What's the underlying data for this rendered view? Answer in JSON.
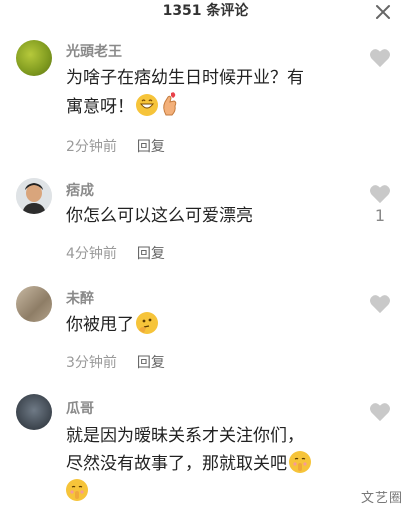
{
  "header": {
    "title": "1351 条评论"
  },
  "comments": [
    {
      "username": "光頭老王",
      "lines": [
        "为啥子在痞幼生日时候开业？有",
        "寓意呀！"
      ],
      "time": "2分钟前",
      "reply_label": "回复",
      "like_count": "",
      "avatar_icon": "green-bush-avatar-icon",
      "emojis": [
        "grin-emoji-icon",
        "finger-heart-emoji-icon"
      ]
    },
    {
      "username": "痞成",
      "lines": [
        "你怎么可以这么可爱漂亮"
      ],
      "time": "4分钟前",
      "reply_label": "回复",
      "like_count": "1",
      "avatar_icon": "person-avatar-icon",
      "emojis": []
    },
    {
      "username": "未醉",
      "lines": [
        "你被甩了"
      ],
      "time": "3分钟前",
      "reply_label": "回复",
      "like_count": "",
      "avatar_icon": "pet-avatar-icon",
      "emojis": [
        "thinking-emoji-icon"
      ]
    },
    {
      "username": "瓜哥",
      "lines": [
        "就是因为暧昧关系才关注你们，",
        "尽然没有故事了，那就取关吧",
        ""
      ],
      "time": "",
      "reply_label": "",
      "like_count": "",
      "avatar_icon": "face-avatar-icon",
      "emojis": [
        "shush-emoji-icon",
        "shush-emoji-icon"
      ]
    }
  ],
  "watermark": "文艺圈",
  "colors": {
    "like_icon": "#c9c9c9",
    "emoji": "#f6c43a"
  }
}
